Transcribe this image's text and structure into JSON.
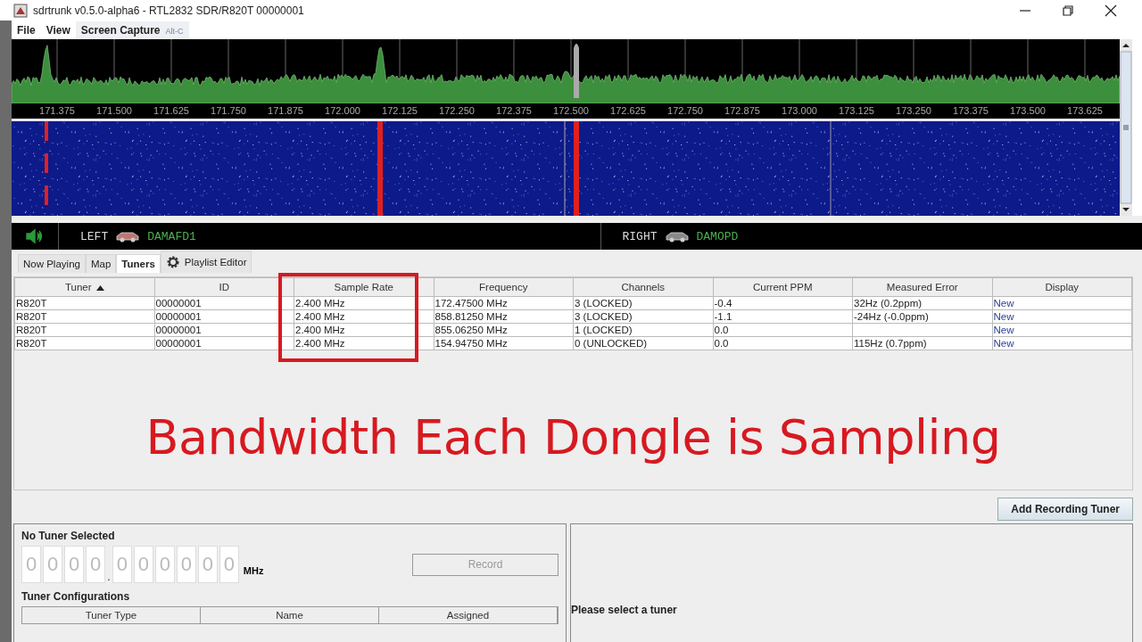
{
  "window": {
    "title": "sdrtrunk v0.5.0-alpha6 - RTL2832 SDR/R820T 00000001"
  },
  "menu": [
    {
      "label": "File",
      "selected": false
    },
    {
      "label": "View",
      "selected": false
    },
    {
      "label": "Screen Capture",
      "accelerator": "Alt-C",
      "selected": true
    }
  ],
  "spectrum": {
    "axis_labels": [
      "171.375",
      "171.500",
      "171.625",
      "171.750",
      "171.875",
      "172.000",
      "172.125",
      "172.250",
      "172.375",
      "172.500",
      "172.625",
      "172.750",
      "172.875",
      "173.000",
      "173.125",
      "173.250",
      "173.375",
      "173.500",
      "173.625"
    ]
  },
  "audio_bar": {
    "channels": [
      {
        "label": "LEFT",
        "alias": "DAMAFD1"
      },
      {
        "label": "RIGHT",
        "alias": "DAMOPD"
      }
    ]
  },
  "tabs": [
    {
      "label": "Now Playing",
      "selected": false,
      "kind": "plain"
    },
    {
      "label": "Map",
      "selected": false,
      "kind": "plain"
    },
    {
      "label": "Tuners",
      "selected": true,
      "kind": "plain"
    },
    {
      "label": "Playlist Editor",
      "selected": false,
      "kind": "settings"
    }
  ],
  "tuner_table": {
    "columns": [
      {
        "label": "Tuner",
        "sorted": true
      },
      {
        "label": "ID"
      },
      {
        "label": "Sample Rate"
      },
      {
        "label": "Frequency"
      },
      {
        "label": "Channels"
      },
      {
        "label": "Current PPM"
      },
      {
        "label": "Measured Error"
      },
      {
        "label": "Display"
      }
    ],
    "rows": [
      [
        "R820T",
        "00000001",
        "2.400 MHz",
        "172.47500 MHz",
        "3 (LOCKED)",
        "-0.4",
        "32Hz (0.2ppm)",
        "New"
      ],
      [
        "R820T",
        "00000001",
        "2.400 MHz",
        "858.81250 MHz",
        "3 (LOCKED)",
        "-1.1",
        "-24Hz (-0.0ppm)",
        "New"
      ],
      [
        "R820T",
        "00000001",
        "2.400 MHz",
        "855.06250 MHz",
        "1 (LOCKED)",
        "0.0",
        "",
        "New"
      ],
      [
        "R820T",
        "00000001",
        "2.400 MHz",
        "154.94750 MHz",
        "0 (UNLOCKED)",
        "0.0",
        "115Hz (0.7ppm)",
        "New"
      ]
    ]
  },
  "annotation": {
    "text": "Bandwidth Each Dongle is Sampling"
  },
  "add_button": {
    "label": "Add Recording Tuner"
  },
  "tuner_panel": {
    "title": "No Tuner Selected",
    "frequency_display": {
      "integer_digits": [
        "0",
        "0",
        "0",
        "0"
      ],
      "separator": ".",
      "decimal_digits": [
        "0",
        "0",
        "0",
        "0",
        "0",
        "0"
      ],
      "unit": "MHz"
    },
    "record_button": {
      "label": "Record",
      "disabled": true
    },
    "configurations": {
      "title": "Tuner Configurations",
      "columns": [
        "Tuner Type",
        "Name",
        "Assigned"
      ]
    }
  },
  "details_panel": {
    "message": "Please select a tuner"
  }
}
